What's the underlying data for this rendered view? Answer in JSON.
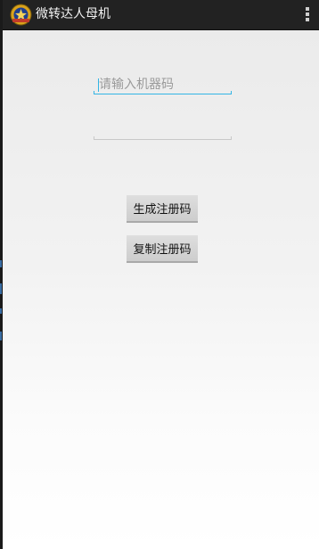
{
  "app": {
    "title": "微转达人母机",
    "icon": "app-badge-icon"
  },
  "action_bar": {
    "overflow_icon": "overflow-menu-icon"
  },
  "form": {
    "machine_code_input": {
      "placeholder": "请输入机器码",
      "value": ""
    },
    "registration_code_input": {
      "placeholder": "",
      "value": ""
    },
    "generate_button": "生成注册码",
    "copy_button": "复制注册码"
  },
  "colors": {
    "action_bar": "#222222",
    "focus_accent": "#33b5e5",
    "button": "#d6d6d6"
  }
}
